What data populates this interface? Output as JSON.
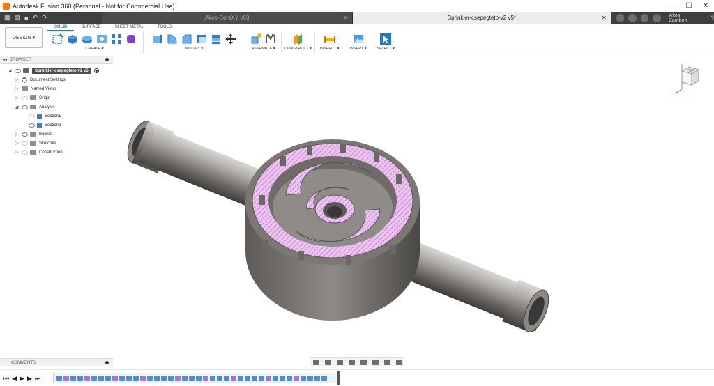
{
  "window": {
    "title": "Autodesk Fusion 360 (Personal - Not for Commercial Use)",
    "controls": [
      "—",
      "☐",
      "✕"
    ]
  },
  "tabs": [
    {
      "label": "Akos-CoreXY v63",
      "active": false
    },
    {
      "label": "Sprinkler-csepegteto-v2 v5*",
      "active": true
    }
  ],
  "account": {
    "user": "Akos Zambon"
  },
  "toolbar": {
    "workspace": "DESIGN ▾",
    "ws_tabs": [
      "SOLID",
      "SURFACE",
      "SHEET METAL",
      "TOOLS"
    ],
    "groups": [
      "CREATE ▾",
      "MODIFY ▾",
      "ASSEMBLE ▾",
      "CONSTRUCT ▾",
      "INSPECT ▾",
      "INSERT ▾",
      "SELECT ▾"
    ]
  },
  "browser": {
    "title": "BROWSER",
    "root": "Sprinkler-csepegteto-v2 v5",
    "items": [
      {
        "label": "Document Settings",
        "type": "gear",
        "expanded": false
      },
      {
        "label": "Named Views",
        "type": "folder",
        "expanded": false
      },
      {
        "label": "Origin",
        "type": "folder",
        "expanded": false
      },
      {
        "label": "Analysis",
        "type": "folder",
        "expanded": true
      },
      {
        "label": "Section1",
        "type": "section",
        "child": true
      },
      {
        "label": "Section2",
        "type": "section",
        "child": true
      },
      {
        "label": "Bodies",
        "type": "folder",
        "expanded": false
      },
      {
        "label": "Sketches",
        "type": "folder",
        "expanded": false
      },
      {
        "label": "Construction",
        "type": "folder",
        "expanded": false
      }
    ]
  },
  "viewcube": {
    "face": "TOP"
  },
  "comments": {
    "title": "COMMENTS"
  },
  "timeline": {
    "controls": [
      "⏮",
      "◀",
      "▶",
      "▶",
      "⏭"
    ]
  },
  "colors": {
    "accent": "#1e79c8",
    "section_fill": "#e8b7ee",
    "metal": "#7a7775",
    "tabbar": "#3d3f42"
  }
}
